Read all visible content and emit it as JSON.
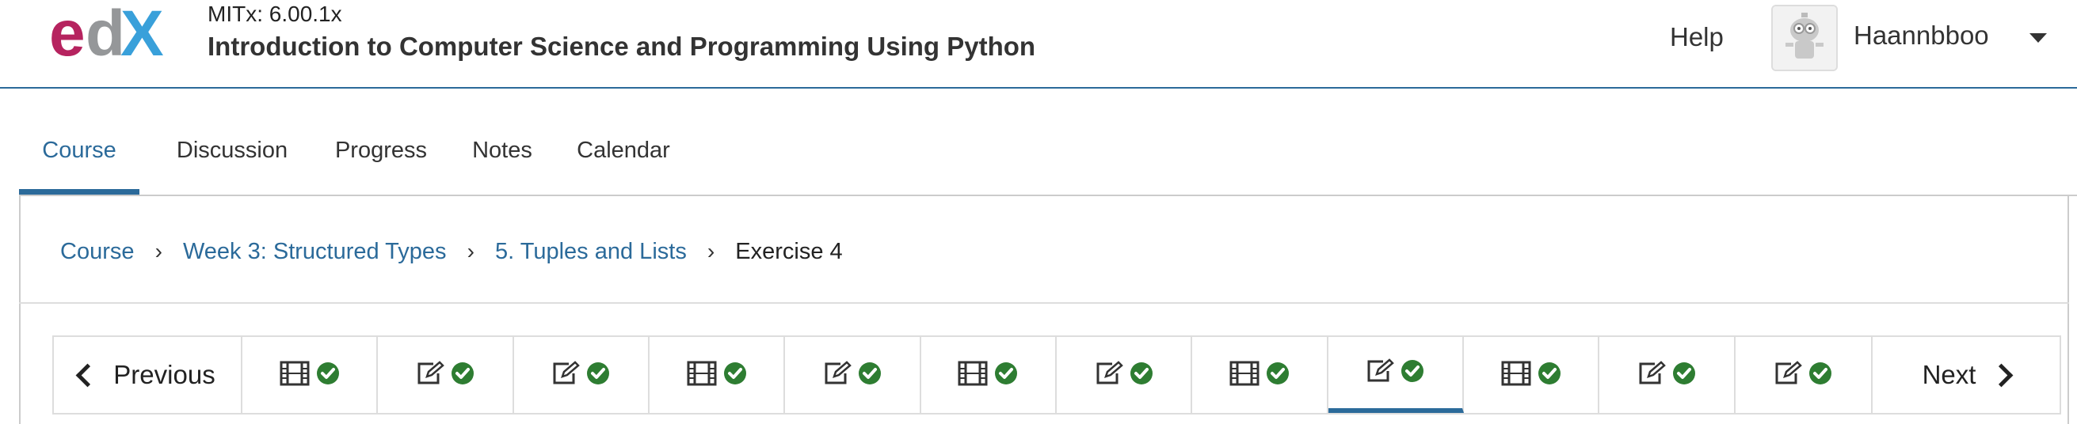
{
  "header": {
    "logo_text": "edX",
    "course_org": "MITx: 6.00.1x",
    "course_title": "Introduction to Computer Science and Programming Using Python",
    "help_label": "Help",
    "username": "Haannbboo"
  },
  "tabs": [
    {
      "label": "Course",
      "active": true
    },
    {
      "label": "Discussion",
      "active": false
    },
    {
      "label": "Progress",
      "active": false
    },
    {
      "label": "Notes",
      "active": false
    },
    {
      "label": "Calendar",
      "active": false
    }
  ],
  "breadcrumb": {
    "items": [
      "Course",
      "Week 3: Structured Types",
      "5. Tuples and Lists"
    ],
    "current": "Exercise 4"
  },
  "sequence_nav": {
    "previous_label": "Previous",
    "next_label": "Next",
    "units": [
      {
        "type": "video-icon",
        "complete": true,
        "active": false
      },
      {
        "type": "problem-icon",
        "complete": true,
        "active": false
      },
      {
        "type": "problem-icon",
        "complete": true,
        "active": false
      },
      {
        "type": "video-icon",
        "complete": true,
        "active": false
      },
      {
        "type": "problem-icon",
        "complete": true,
        "active": false
      },
      {
        "type": "video-icon",
        "complete": true,
        "active": false
      },
      {
        "type": "problem-icon",
        "complete": true,
        "active": false
      },
      {
        "type": "video-icon",
        "complete": true,
        "active": false
      },
      {
        "type": "problem-icon",
        "complete": true,
        "active": true
      },
      {
        "type": "video-icon",
        "complete": true,
        "active": false
      },
      {
        "type": "problem-icon",
        "complete": true,
        "active": false
      },
      {
        "type": "problem-icon",
        "complete": true,
        "active": false
      }
    ]
  },
  "colors": {
    "accent": "#2b6a9a",
    "check": "#2e7d32",
    "logo_magenta": "#b6235f",
    "logo_gray": "#8a8c8e",
    "logo_blue": "#2f9bd9"
  }
}
